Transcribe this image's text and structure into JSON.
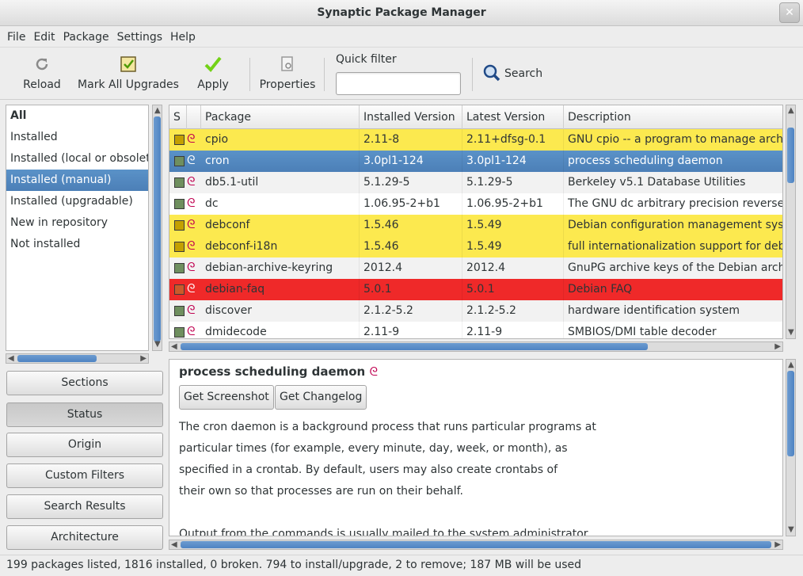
{
  "window": {
    "title": "Synaptic Package Manager",
    "close_glyph": "✕"
  },
  "menu": [
    "File",
    "Edit",
    "Package",
    "Settings",
    "Help"
  ],
  "toolbar": {
    "reload": "Reload",
    "mark_all": "Mark All Upgrades",
    "apply": "Apply",
    "properties": "Properties",
    "quick_filter_label": "Quick filter",
    "quick_filter_value": "",
    "search": "Search"
  },
  "filters": [
    "All",
    "Installed",
    "Installed (local or obsolete)",
    "Installed (manual)",
    "Installed (upgradable)",
    "New in repository",
    "Not installed"
  ],
  "selected_filter": "Installed (manual)",
  "side_buttons": [
    "Sections",
    "Status",
    "Origin",
    "Custom Filters",
    "Search Results",
    "Architecture"
  ],
  "table": {
    "headers": [
      "S",
      "Package",
      "Installed Version",
      "Latest Version",
      "Description"
    ],
    "rows": [
      {
        "state": "upgrade",
        "name": "cpio",
        "installed": "2.11-8",
        "latest": "2.11+dfsg-0.1",
        "desc": "GNU cpio -- a program to manage archives"
      },
      {
        "state": "selected",
        "name": "cron",
        "installed": "3.0pl1-124",
        "latest": "3.0pl1-124",
        "desc": "process scheduling daemon"
      },
      {
        "state": "installed",
        "name": "db5.1-util",
        "installed": "5.1.29-5",
        "latest": "5.1.29-5",
        "desc": "Berkeley v5.1 Database Utilities"
      },
      {
        "state": "installed",
        "name": "dc",
        "installed": "1.06.95-2+b1",
        "latest": "1.06.95-2+b1",
        "desc": "The GNU dc arbitrary precision reverse-p"
      },
      {
        "state": "upgrade",
        "name": "debconf",
        "installed": "1.5.46",
        "latest": "1.5.49",
        "desc": "Debian configuration management system"
      },
      {
        "state": "upgrade",
        "name": "debconf-i18n",
        "installed": "1.5.46",
        "latest": "1.5.49",
        "desc": "full internationalization support for debc"
      },
      {
        "state": "installed",
        "name": "debian-archive-keyring",
        "installed": "2012.4",
        "latest": "2012.4",
        "desc": "GnuPG archive keys of the Debian archive"
      },
      {
        "state": "remove",
        "name": "debian-faq",
        "installed": "5.0.1",
        "latest": "5.0.1",
        "desc": "Debian FAQ"
      },
      {
        "state": "installed",
        "name": "discover",
        "installed": "2.1.2-5.2",
        "latest": "2.1.2-5.2",
        "desc": "hardware identification system"
      },
      {
        "state": "installed",
        "name": "dmidecode",
        "installed": "2.11-9",
        "latest": "2.11-9",
        "desc": "SMBIOS/DMI table decoder"
      }
    ]
  },
  "detail": {
    "title": "process scheduling daemon",
    "get_screenshot": "Get Screenshot",
    "get_changelog": "Get Changelog",
    "lines": [
      "The cron daemon is a background process that runs particular programs at",
      "particular times (for example, every minute, day, week, or month), as",
      "specified in a crontab. By default, users may also create crontabs of",
      "their own so that processes are run on their behalf.",
      "",
      "Output from the commands is usually mailed to the system administrator"
    ]
  },
  "status": "199 packages listed, 1816 installed, 0 broken. 794 to install/upgrade, 2 to remove; 187 MB will be used",
  "colors": {
    "upgrade": "#fce94f",
    "selected": "#4c7fb7",
    "remove": "#ef2929"
  },
  "icons": [
    "reload-icon",
    "mark-upgrades-icon",
    "apply-check-icon",
    "properties-icon",
    "search-icon",
    "debian-swirl-icon"
  ]
}
